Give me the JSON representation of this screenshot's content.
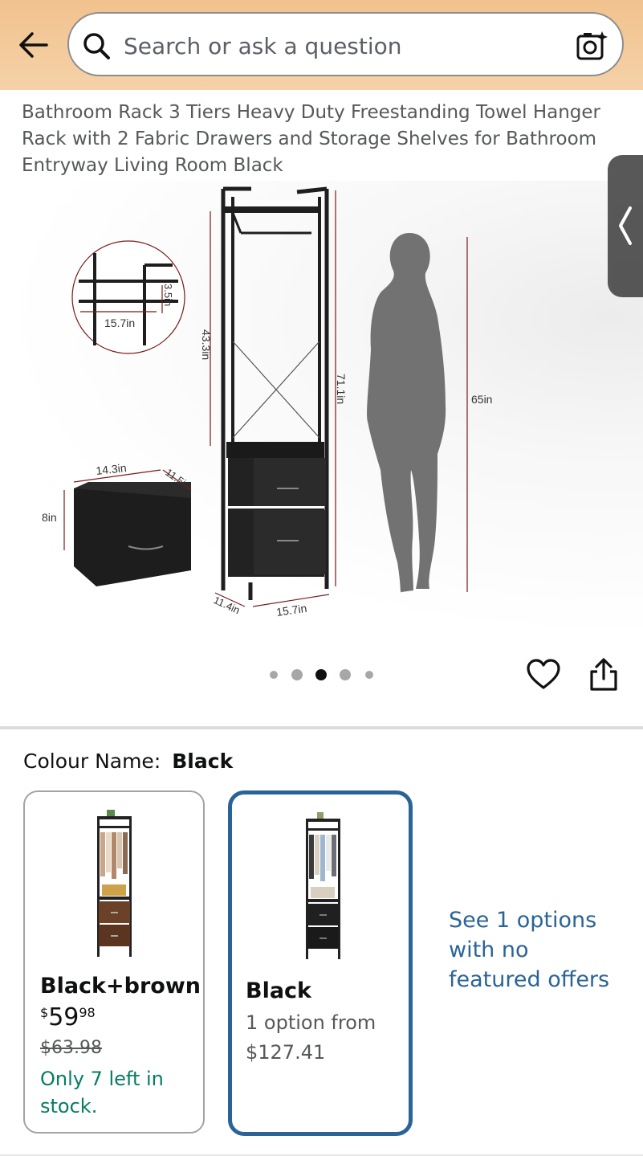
{
  "search": {
    "placeholder": "Search or ask a question"
  },
  "product": {
    "title": "Bathroom Rack 3 Tiers Heavy Duty Freestanding Towel Hanger Rack with 2 Fabric Drawers and Storage Shelves for Bathroom Entryway Living Room Black",
    "dimensions": {
      "detail_height": "3.5in",
      "detail_width": "15.7in",
      "upper_height": "43.3in",
      "total_height": "71.1in",
      "person_height": "65in",
      "drawer_width": "14.3in",
      "drawer_depth": "11.5in",
      "drawer_height": "8in",
      "base_depth": "11.4in",
      "base_width": "15.7in"
    },
    "image_count": 5,
    "active_image_index": 2
  },
  "variations": {
    "label": "Colour Name:",
    "selected": "Black",
    "options": [
      {
        "name": "Black+brown",
        "price_symbol": "$",
        "price_whole": "59",
        "price_fraction": "98",
        "was_price": "$63.98",
        "stock_note": "Only 7 left in stock."
      },
      {
        "name": "Black",
        "option_line": "1 option from",
        "price": "$127.41"
      }
    ],
    "see_more": "See 1 options with no featured offers"
  },
  "colors": {
    "header_bg": "#f1c28e",
    "link": "#2a6497",
    "stock_green": "#067d62",
    "selected_border": "#2a6497",
    "dimension_line": "#7a1a1a"
  }
}
